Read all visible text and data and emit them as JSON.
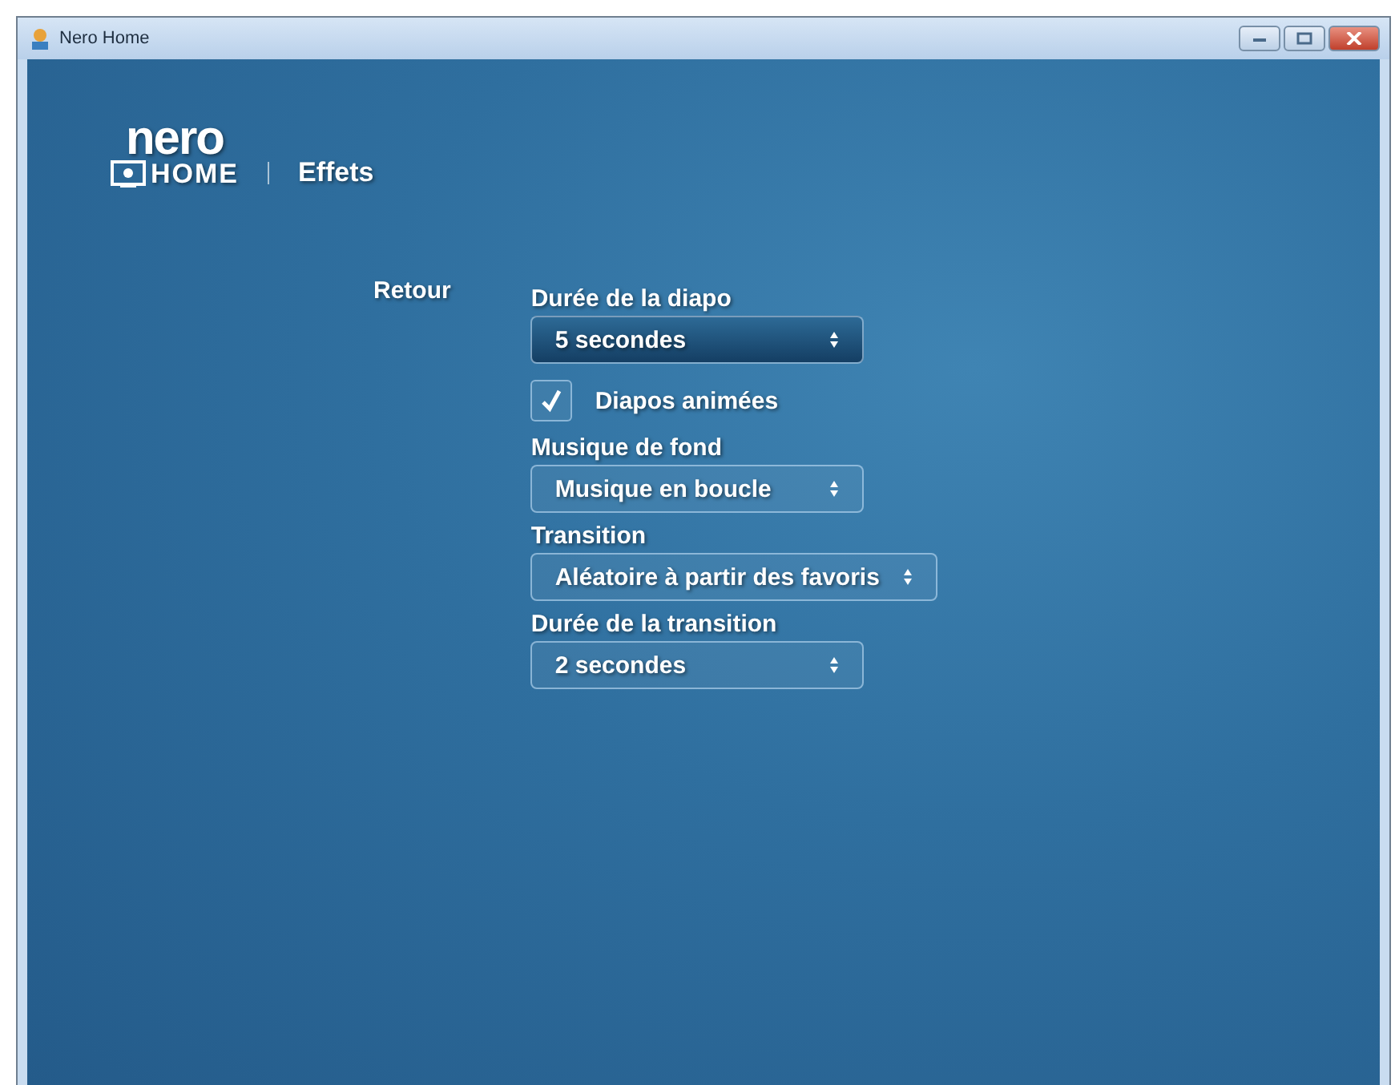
{
  "window": {
    "title": "Nero Home"
  },
  "logo": {
    "brand": "nero",
    "product": "HOME"
  },
  "page_title": "Effets",
  "back_link": "Retour",
  "settings": [
    {
      "kind": "dropdown",
      "label": "Durée de la diapo",
      "value": "5 secondes",
      "selected": true
    },
    {
      "kind": "checkbox",
      "label": "Diapos animées",
      "checked": true
    },
    {
      "kind": "dropdown",
      "label": "Musique de fond",
      "value": "Musique en boucle",
      "selected": false
    },
    {
      "kind": "dropdown",
      "label": "Transition",
      "value": "Aléatoire à partir des favoris",
      "selected": false
    },
    {
      "kind": "dropdown",
      "label": "Durée de la transition",
      "value": "2 secondes",
      "selected": false
    }
  ]
}
